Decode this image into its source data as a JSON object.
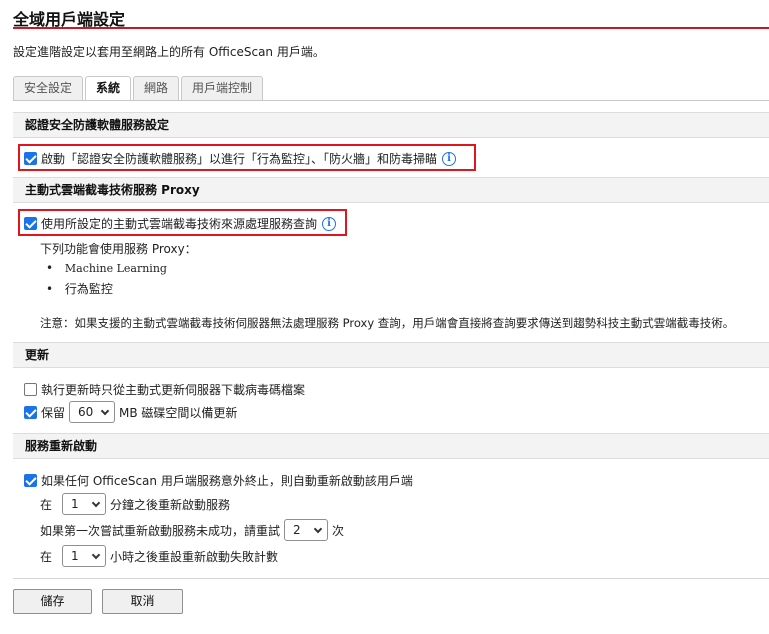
{
  "page": {
    "title": "全域用戶端設定",
    "intro_prefix": "設定進階設定以套用至網路上的所有 ",
    "intro_product": "OfficeScan",
    "intro_suffix": " 用戶端。"
  },
  "tabs": [
    {
      "label": "安全設定",
      "active": false
    },
    {
      "label": "系統",
      "active": true
    },
    {
      "label": "網路",
      "active": false
    },
    {
      "label": "用戶端控制",
      "active": false
    }
  ],
  "certified_av": {
    "heading": "認證安全防護軟體服務設定",
    "option": {
      "label": "啟動「認證安全防護軟體服務」以進行「行為監控」、「防火牆」和防毒掃瞄",
      "checked": true
    }
  },
  "proxy": {
    "heading": "主動式雲端截毒技術服務 Proxy",
    "option": {
      "label": "使用所設定的主動式雲端截毒技術來源處理服務查詢",
      "checked": true
    },
    "features_intro": "下列功能會使用服務 Proxy：",
    "features": [
      "Machine Learning",
      "行為監控"
    ],
    "note": "注意：如果支援的主動式雲端截毒技術伺服器無法處理服務 Proxy 查詢，用戶端會直接將查詢要求傳送到趨勢科技主動式雲端截毒技術。"
  },
  "update": {
    "heading": "更新",
    "download_option": {
      "label": "執行更新時只從主動式更新伺服器下載病毒碼檔案",
      "checked": false
    },
    "reserve_option": {
      "prefix": "保留",
      "value": "60",
      "suffix": "MB 磁碟空間以備更新",
      "checked": true
    }
  },
  "restart": {
    "heading": "服務重新啟動",
    "auto_option": {
      "label": "如果任何 OfficeScan 用戶端服務意外終止，則自動重新啟動該用戶端",
      "checked": true
    },
    "minutes": {
      "prefix": "在",
      "value": "1",
      "suffix": "分鐘之後重新啟動服務"
    },
    "retries": {
      "prefix": "如果第一次嘗試重新啟動服務未成功，請重試",
      "value": "2",
      "suffix": "次"
    },
    "hours": {
      "prefix": "在",
      "value": "1",
      "suffix": "小時之後重設重新啟動失敗計數"
    }
  },
  "buttons": {
    "save": "儲存",
    "cancel": "取消"
  },
  "icons": {
    "info": "info-icon",
    "check": "checkmark-icon",
    "dropdown": "chevron-down-icon"
  },
  "colors": {
    "accent": "#c21b24",
    "checkbox": "#1a73e8",
    "highlight_box": "#e0151e"
  }
}
